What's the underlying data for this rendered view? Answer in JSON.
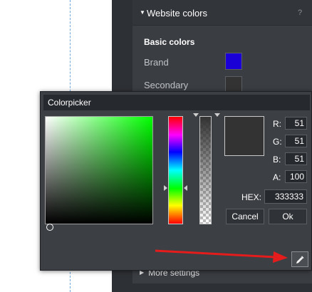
{
  "settings": {
    "section_title": "Website colors",
    "help_glyph": "?",
    "basic_colors_title": "Basic colors",
    "colors": [
      {
        "label": "Brand",
        "value": "#1a00d6"
      },
      {
        "label": "Secondary",
        "value": "#333333"
      }
    ],
    "more_settings_label": "More settings"
  },
  "colorpicker": {
    "title": "Colorpicker",
    "channels": {
      "r_label": "R:",
      "r_value": "51",
      "g_label": "G:",
      "g_value": "51",
      "b_label": "B:",
      "b_value": "51",
      "a_label": "A:",
      "a_value": "100"
    },
    "hex_label": "HEX:",
    "hex_value": "333333",
    "cancel_label": "Cancel",
    "ok_label": "Ok",
    "preview_color": "#333333",
    "hue_color": "#00ff00",
    "eyedropper_icon": "eyedropper-icon"
  },
  "annotation": {
    "arrow_color": "#e51c1c"
  }
}
